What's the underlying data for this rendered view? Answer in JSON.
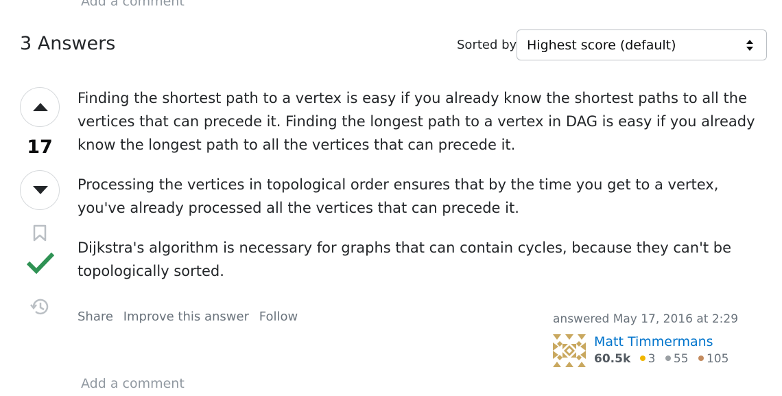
{
  "top_comment_link": "Add a comment",
  "header": {
    "answers_count": "3 Answers",
    "sort_label": "Sorted by:",
    "sort_selected": "Highest score (default)"
  },
  "vote": {
    "score": "17"
  },
  "answer": {
    "paragraphs": [
      "Finding the shortest path to a vertex is easy if you already know the shortest paths to all the vertices that can precede it. Finding the longest path to a vertex in DAG is easy if you already know the longest path to all the vertices that can precede it.",
      "Processing the vertices in topological order ensures that by the time you get to a vertex, you've already processed all the vertices that can precede it.",
      "Dijkstra's algorithm is necessary for graphs that can contain cycles, because they can't be topologically sorted."
    ],
    "menu": {
      "share": "Share",
      "improve": "Improve this answer",
      "follow": "Follow"
    }
  },
  "user": {
    "action": "answered",
    "timestamp": "May 17, 2016 at 2:29",
    "name": "Matt Timmermans",
    "reputation": "60.5k",
    "gold": "3",
    "silver": "55",
    "bronze": "105"
  },
  "bottom_comment_link": "Add a comment",
  "colors": {
    "accepted": "#2f9254",
    "link": "#0074cc",
    "gold": "#f1b600",
    "silver": "#9a9fa3",
    "bronze": "#c38b5f"
  }
}
